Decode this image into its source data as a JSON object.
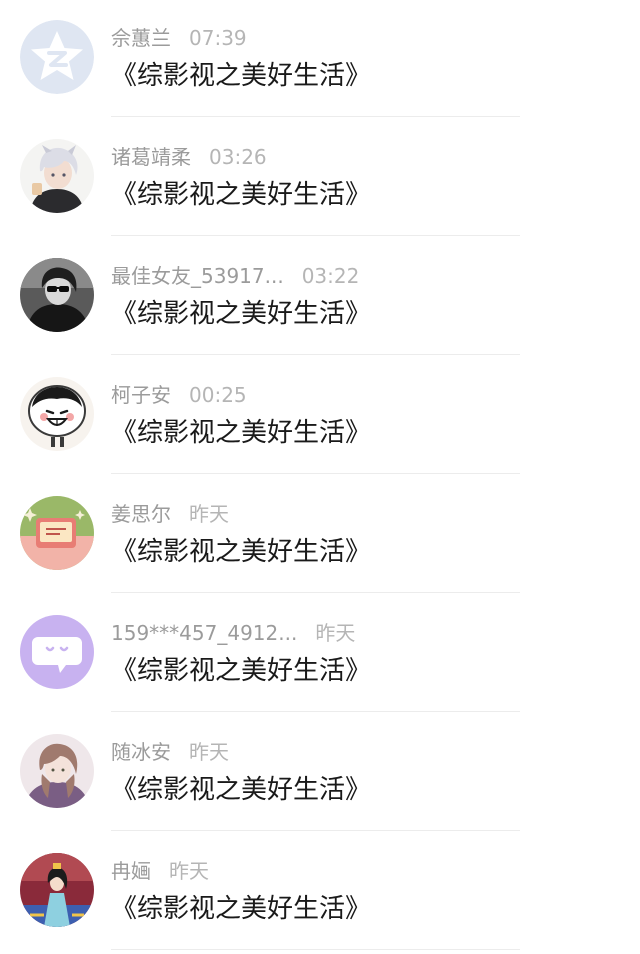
{
  "comments": [
    {
      "name": "佘蕙兰",
      "time": "07:39",
      "message": "《综影视之美好生活》",
      "avatar": "default-qq-avatar"
    },
    {
      "name": "诸葛靖柔",
      "time": "03:26",
      "message": "《综影视之美好生活》",
      "avatar": "anime-silver-hair-boy"
    },
    {
      "name": "最佳女友_53917...",
      "time": "03:22",
      "message": "《综影视之美好生活》",
      "avatar": "black-white-girl-sunglasses"
    },
    {
      "name": "柯子安",
      "time": "00:25",
      "message": "《综影视之美好生活》",
      "avatar": "cartoon-laughing-face"
    },
    {
      "name": "姜思尔",
      "time": "昨天",
      "message": "《综影视之美好生活》",
      "avatar": "green-pink-card-illustration"
    },
    {
      "name": "159***457_4912...",
      "time": "昨天",
      "message": "《综影视之美好生活》",
      "avatar": "purple-chat-bubble"
    },
    {
      "name": "随冰安",
      "time": "昨天",
      "message": "《综影视之美好生活》",
      "avatar": "anime-girl-purple"
    },
    {
      "name": "冉婳",
      "time": "昨天",
      "message": "《综影视之美好生活》",
      "avatar": "illustrated-princess"
    }
  ]
}
